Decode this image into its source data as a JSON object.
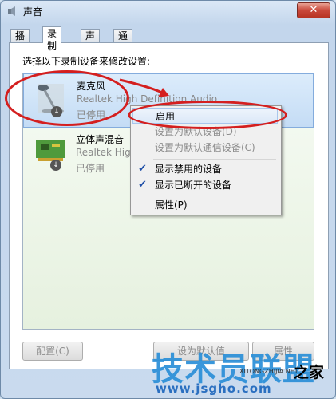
{
  "window": {
    "title": "声音",
    "close_label": "✕"
  },
  "tabs": [
    {
      "label": "播放",
      "active": false
    },
    {
      "label": "录制",
      "active": true
    },
    {
      "label": "声音",
      "active": false
    },
    {
      "label": "通信",
      "active": false
    }
  ],
  "panel": {
    "prompt": "选择以下录制设备来修改设置:"
  },
  "devices": [
    {
      "name": "麦克风",
      "description": "Realtek High Definition Audio",
      "status": "已停用",
      "icon": "microphone-icon",
      "selected": true
    },
    {
      "name": "立体声混音",
      "description": "Realtek High D",
      "status": "已停用",
      "icon": "sound-card-icon",
      "selected": false
    }
  ],
  "context_menu": {
    "items": [
      {
        "label": "启用",
        "enabled": true,
        "checked": false
      },
      {
        "label": "设置为默认设备(D)",
        "enabled": false,
        "checked": false
      },
      {
        "label": "设置为默认通信设备(C)",
        "enabled": false,
        "checked": false
      },
      {
        "label": "显示禁用的设备",
        "enabled": true,
        "checked": true
      },
      {
        "label": "显示已断开的设备",
        "enabled": true,
        "checked": true
      },
      {
        "label": "属性(P)",
        "enabled": true,
        "checked": false
      }
    ]
  },
  "buttons": {
    "configure": "配置(C)",
    "set_default": "设为默认值",
    "properties": "属性"
  },
  "watermark": {
    "main": "技术员联盟",
    "suffix": "之家",
    "url": "www.jsgho.com",
    "small": "XITONGZHIJIA.NET"
  },
  "colors": {
    "annotation": "#d41f1f",
    "accent": "#2a8fd8",
    "selection": "#c4dcf5"
  }
}
